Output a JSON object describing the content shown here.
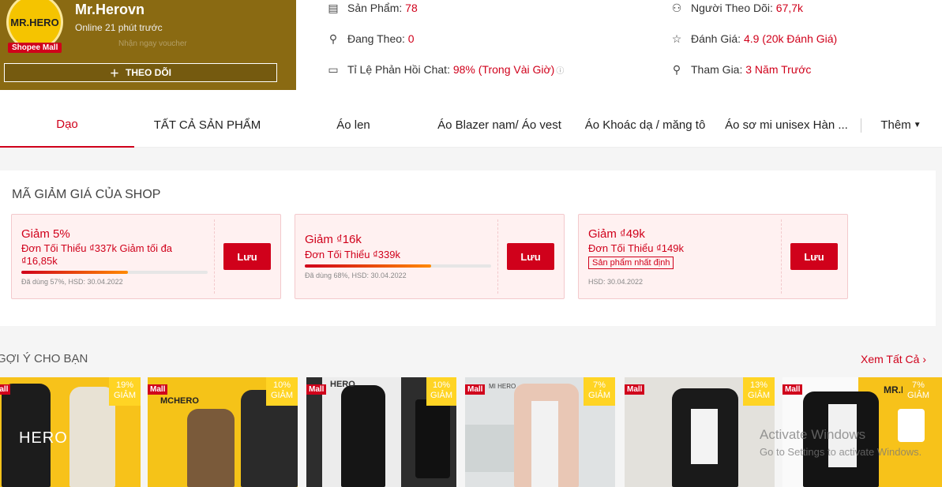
{
  "shop": {
    "logo_text": "MR.HERO",
    "mall_badge": "Shopee Mall",
    "name": "Mr.Herovn",
    "online": "Online 21 phút trước",
    "follow_label": "THEO DÕI",
    "banner_text": "Nhận ngay voucher"
  },
  "stats": {
    "products": {
      "label": "Sản Phẩm:",
      "value": "78"
    },
    "following": {
      "label": "Đang Theo:",
      "value": "0"
    },
    "chat": {
      "label": "Tỉ Lệ Phản Hồi Chat:",
      "value": "98% (Trong Vài Giờ)"
    },
    "followers": {
      "label": "Người Theo Dõi:",
      "value": "67,7k"
    },
    "rating": {
      "label": "Đánh Giá:",
      "value": "4.9 (20k Đánh Giá)"
    },
    "joined": {
      "label": "Tham Gia:",
      "value": "3 Năm Trước"
    }
  },
  "tabs": [
    "Dạo",
    "TẤT CẢ SẢN PHẨM",
    "Áo len",
    "Áo Blazer nam/ Áo vest",
    "Áo Khoác dạ / măng tô",
    "Áo sơ mi unisex Hàn ...",
    "Thêm"
  ],
  "vouchers_title": "MÃ GIẢM GIÁ CỦA SHOP",
  "vouchers": [
    {
      "title": "Giảm 5%",
      "cond": "Đơn Tối Thiểu ₫337k Giảm tối đa ₫16,85k",
      "used_fraction": 0.57,
      "meta": "Đã dùng 57%, HSD: 30.04.2022",
      "button": "Lưu"
    },
    {
      "title": "Giảm ₫16k",
      "cond": "Đơn Tối Thiểu ₫339k",
      "used_fraction": 0.68,
      "meta": "Đã dùng 68%, HSD: 30.04.2022",
      "button": "Lưu"
    },
    {
      "title": "Giảm ₫49k",
      "cond": "Đơn Tối Thiểu ₫149k",
      "tag": "Sản phẩm nhất định",
      "meta": "HSD: 30.04.2022",
      "button": "Lưu"
    }
  ],
  "suggest": {
    "title": "GỢI Ý CHO BẠN",
    "see_all": "Xem Tất Cả"
  },
  "products": [
    {
      "discount": "19%",
      "label": "GIẢM",
      "mall": "Mall",
      "brand": "HERO"
    },
    {
      "discount": "10%",
      "label": "GIẢM",
      "mall": "Mall",
      "brand": "MCHERO"
    },
    {
      "discount": "10%",
      "label": "GIẢM",
      "mall": "Mall",
      "brand": "HERO"
    },
    {
      "discount": "7%",
      "label": "GIẢM",
      "mall": "Mall",
      "brand": "MI HERO"
    },
    {
      "discount": "13%",
      "label": "GIẢM",
      "mall": "Mall",
      "brand": ""
    },
    {
      "discount": "7%",
      "label": "GIẢM",
      "mall": "Mall",
      "brand": "MR.HE"
    }
  ],
  "watermark": {
    "line1": "Activate Windows",
    "line2": "Go to Settings to activate Windows."
  },
  "colors": {
    "accent": "#d0011b",
    "discount": "#ffd424"
  }
}
